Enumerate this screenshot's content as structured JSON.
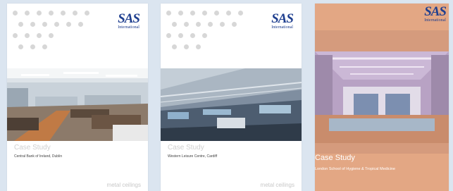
{
  "brand": {
    "logo_text": "SAS",
    "logo_sub": "International",
    "logo_color": "#1f3f8f"
  },
  "cards": [
    {
      "title": "Case Study",
      "subtitle": "Central Bank of Ireland, Dublin",
      "footer": "metal ceilings"
    },
    {
      "title": "Case Study",
      "subtitle": "Western Leisure Centre, Cardiff",
      "footer": "metal ceilings"
    },
    {
      "title": "Case Study",
      "subtitle": "London School of Hygiene & Tropical Medicine",
      "background": "#e3a784"
    }
  ]
}
